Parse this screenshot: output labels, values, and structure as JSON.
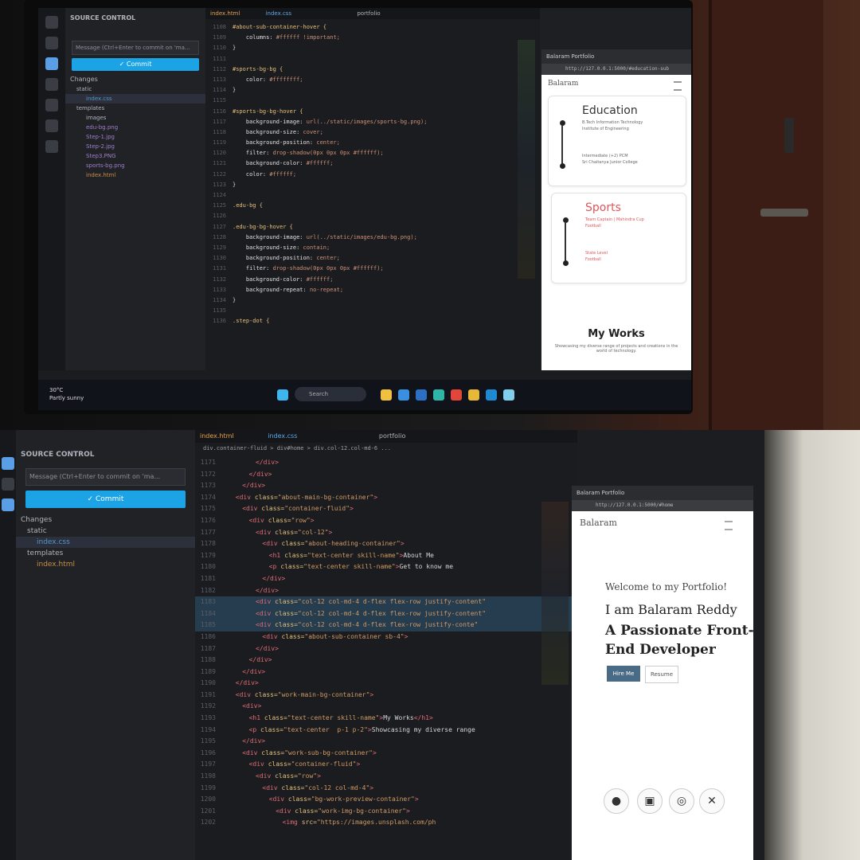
{
  "top": {
    "explorer": {
      "title": "SOURCE CONTROL",
      "commit_placeholder": "Message (Ctrl+Enter to commit on 'ma...",
      "commit_label": "✓ Commit",
      "changes_label": "Changes",
      "items": [
        "static",
        "index.css",
        "templates",
        "images",
        "edu-bg.png",
        "Step-1.jpg",
        "Step-2.jpg",
        "Step3.PNG",
        "sports-bg.png",
        "index.html"
      ]
    },
    "tabs": [
      "index.html",
      "index.css",
      "portfolio"
    ],
    "code_lines": [
      {
        "n": "1108",
        "parts": [
          [
            "sel",
            "#about-sub-container-hover {"
          ]
        ]
      },
      {
        "n": "1109",
        "parts": [
          [
            "prop",
            "    columns: "
          ],
          [
            "val",
            "#ffffff !important;"
          ]
        ]
      },
      {
        "n": "1110",
        "parts": [
          [
            "txt",
            "}"
          ]
        ]
      },
      {
        "n": "1111",
        "parts": [
          [
            "txt",
            ""
          ]
        ]
      },
      {
        "n": "1112",
        "parts": [
          [
            "sel",
            "#sports-bg-bg {"
          ]
        ]
      },
      {
        "n": "1113",
        "parts": [
          [
            "prop",
            "    color: "
          ],
          [
            "val",
            "#ffffffff;"
          ]
        ]
      },
      {
        "n": "1114",
        "parts": [
          [
            "txt",
            "}"
          ]
        ]
      },
      {
        "n": "1115",
        "parts": [
          [
            "txt",
            ""
          ]
        ]
      },
      {
        "n": "1116",
        "parts": [
          [
            "sel",
            "#sports-bg-bg-hover {"
          ]
        ]
      },
      {
        "n": "1117",
        "parts": [
          [
            "prop",
            "    background-image: "
          ],
          [
            "val",
            "url(../static/images/sports-bg.png);"
          ]
        ]
      },
      {
        "n": "1118",
        "parts": [
          [
            "prop",
            "    background-size: "
          ],
          [
            "val",
            "cover;"
          ]
        ]
      },
      {
        "n": "1119",
        "parts": [
          [
            "prop",
            "    background-position: "
          ],
          [
            "val",
            "center;"
          ]
        ]
      },
      {
        "n": "1120",
        "parts": [
          [
            "prop",
            "    filter: "
          ],
          [
            "val",
            "drop-shadow(0px 0px 0px #ffffff);"
          ]
        ]
      },
      {
        "n": "1121",
        "parts": [
          [
            "prop",
            "    background-color: "
          ],
          [
            "val",
            "#ffffff;"
          ]
        ]
      },
      {
        "n": "1122",
        "parts": [
          [
            "prop",
            "    color: "
          ],
          [
            "val",
            "#ffffff;"
          ]
        ]
      },
      {
        "n": "1123",
        "parts": [
          [
            "txt",
            "}"
          ]
        ]
      },
      {
        "n": "1124",
        "parts": [
          [
            "txt",
            ""
          ]
        ]
      },
      {
        "n": "1125",
        "parts": [
          [
            "sel",
            ".edu-bg {"
          ]
        ]
      },
      {
        "n": "1126",
        "parts": [
          [
            "txt",
            ""
          ]
        ]
      },
      {
        "n": "1127",
        "parts": [
          [
            "sel",
            ".edu-bg-bg-hover {"
          ]
        ]
      },
      {
        "n": "1128",
        "parts": [
          [
            "prop",
            "    background-image: "
          ],
          [
            "val",
            "url(../static/images/edu-bg.png);"
          ]
        ]
      },
      {
        "n": "1129",
        "parts": [
          [
            "prop",
            "    background-size: "
          ],
          [
            "val",
            "contain;"
          ]
        ]
      },
      {
        "n": "1130",
        "parts": [
          [
            "prop",
            "    background-position: "
          ],
          [
            "val",
            "center;"
          ]
        ]
      },
      {
        "n": "1131",
        "parts": [
          [
            "prop",
            "    filter: "
          ],
          [
            "val",
            "drop-shadow(0px 0px 0px #ffffff);"
          ]
        ]
      },
      {
        "n": "1132",
        "parts": [
          [
            "prop",
            "    background-color: "
          ],
          [
            "val",
            "#ffffff;"
          ]
        ]
      },
      {
        "n": "1133",
        "parts": [
          [
            "prop",
            "    background-repeat: "
          ],
          [
            "val",
            "no-repeat;"
          ]
        ]
      },
      {
        "n": "1134",
        "parts": [
          [
            "txt",
            "}"
          ]
        ]
      },
      {
        "n": "1135",
        "parts": [
          [
            "txt",
            ""
          ]
        ]
      },
      {
        "n": "1136",
        "parts": [
          [
            "sel",
            ".step-dot {"
          ]
        ]
      }
    ],
    "browser": {
      "tab_title": "Balaram Portfolio",
      "url": "http://127.0.0.1:5000/#education-sub",
      "site_name": "Balaram",
      "education_title": "Education",
      "education_line1": "B.Tech Information Technology",
      "education_line2": "Institute of Engineering",
      "education_line3": "Intermediate (+2) PCM",
      "education_line4": "Sri Chaitanya Junior College",
      "sports_title": "Sports",
      "sports_line1": "Team Captain | Mahindra Cup",
      "sports_line2": "Football",
      "sports_line3": "State Level",
      "sports_line4": "Football",
      "works_title": "My Works",
      "works_line": "Showcasing my diverse range of projects and creations in the world of technology."
    },
    "taskbar": {
      "search_label": "Search",
      "weather_temp": "30°C",
      "weather_desc": "Partly sunny"
    }
  },
  "bottom": {
    "explorer": {
      "title": "SOURCE CONTROL",
      "commit_placeholder": "Message (Ctrl+Enter to commit on 'ma...",
      "commit_label": "✓ Commit",
      "changes_label": "Changes",
      "items": [
        "static",
        "index.css",
        "templates",
        "index.html"
      ]
    },
    "tabs": [
      "index.html",
      "index.css",
      "portfolio"
    ],
    "breadcrumb": "div.container-fluid > div#home > div.col-12.col-md-6 ...",
    "code_lines": [
      {
        "n": "1171",
        "indent": 10,
        "parts": [
          [
            "tag",
            "</div>"
          ]
        ]
      },
      {
        "n": "1172",
        "indent": 8,
        "parts": [
          [
            "tag",
            "</div>"
          ]
        ]
      },
      {
        "n": "1173",
        "indent": 6,
        "parts": [
          [
            "tag",
            "</div>"
          ]
        ]
      },
      {
        "n": "1174",
        "indent": 4,
        "parts": [
          [
            "tag",
            "<div "
          ],
          [
            "attr",
            "class="
          ],
          [
            "str",
            "\"about-main-bg-container\""
          ],
          [
            "tag",
            ">"
          ]
        ]
      },
      {
        "n": "1175",
        "indent": 6,
        "parts": [
          [
            "tag",
            "<div "
          ],
          [
            "attr",
            "class="
          ],
          [
            "str",
            "\"container-fluid\""
          ],
          [
            "tag",
            ">"
          ]
        ]
      },
      {
        "n": "1176",
        "indent": 8,
        "parts": [
          [
            "tag",
            "<div "
          ],
          [
            "attr",
            "class="
          ],
          [
            "str",
            "\"row\""
          ],
          [
            "tag",
            ">"
          ]
        ]
      },
      {
        "n": "1177",
        "indent": 10,
        "parts": [
          [
            "tag",
            "<div "
          ],
          [
            "attr",
            "class="
          ],
          [
            "str",
            "\"col-12\""
          ],
          [
            "tag",
            ">"
          ]
        ]
      },
      {
        "n": "1178",
        "indent": 12,
        "parts": [
          [
            "tag",
            "<div "
          ],
          [
            "attr",
            "class="
          ],
          [
            "str",
            "\"about-heading-container\""
          ],
          [
            "tag",
            ">"
          ]
        ]
      },
      {
        "n": "1179",
        "indent": 14,
        "parts": [
          [
            "tag",
            "<h1 "
          ],
          [
            "attr",
            "class="
          ],
          [
            "str",
            "\"text-center skill-name\""
          ],
          [
            "tag",
            ">"
          ],
          [
            "txt",
            "About Me"
          ]
        ]
      },
      {
        "n": "1180",
        "indent": 14,
        "parts": [
          [
            "tag",
            "<p "
          ],
          [
            "attr",
            "class="
          ],
          [
            "str",
            "\"text-center skill-name\""
          ],
          [
            "tag",
            ">"
          ],
          [
            "txt",
            "Get to know me"
          ]
        ]
      },
      {
        "n": "1181",
        "indent": 12,
        "parts": [
          [
            "tag",
            "</div>"
          ]
        ]
      },
      {
        "n": "1182",
        "indent": 10,
        "parts": [
          [
            "tag",
            "</div>"
          ]
        ]
      },
      {
        "n": "1183",
        "indent": 10,
        "parts": [
          [
            "tag",
            "<div "
          ],
          [
            "attr",
            "class="
          ],
          [
            "str",
            "\"col-12 col-md-4 d-flex flex-row justify-content\""
          ]
        ]
      },
      {
        "n": "1184",
        "indent": 10,
        "parts": [
          [
            "tag",
            "<div "
          ],
          [
            "attr",
            "class="
          ],
          [
            "str",
            "\"col-12 col-md-4 d-flex flex-row justify-content\""
          ]
        ]
      },
      {
        "n": "1185",
        "indent": 10,
        "parts": [
          [
            "tag",
            "<div "
          ],
          [
            "attr",
            "class="
          ],
          [
            "str",
            "\"col-12 col-md-4 d-flex flex-row justify-conte\""
          ]
        ]
      },
      {
        "n": "1186",
        "indent": 12,
        "parts": [
          [
            "tag",
            "<div "
          ],
          [
            "attr",
            "class="
          ],
          [
            "str",
            "\"about-sub-container sb-4\""
          ],
          [
            "tag",
            ">"
          ]
        ]
      },
      {
        "n": "1187",
        "indent": 10,
        "parts": [
          [
            "tag",
            "</div>"
          ]
        ]
      },
      {
        "n": "1188",
        "indent": 8,
        "parts": [
          [
            "tag",
            "</div>"
          ]
        ]
      },
      {
        "n": "1189",
        "indent": 6,
        "parts": [
          [
            "tag",
            "</div>"
          ]
        ]
      },
      {
        "n": "1190",
        "indent": 4,
        "parts": [
          [
            "tag",
            "</div>"
          ]
        ]
      },
      {
        "n": "1191",
        "indent": 4,
        "parts": [
          [
            "tag",
            "<div "
          ],
          [
            "attr",
            "class="
          ],
          [
            "str",
            "\"work-main-bg-container\""
          ],
          [
            "tag",
            ">"
          ]
        ]
      },
      {
        "n": "1192",
        "indent": 6,
        "parts": [
          [
            "tag",
            "<div>"
          ]
        ]
      },
      {
        "n": "1193",
        "indent": 8,
        "parts": [
          [
            "tag",
            "<h1 "
          ],
          [
            "attr",
            "class="
          ],
          [
            "str",
            "\"text-center skill-name\""
          ],
          [
            "tag",
            ">"
          ],
          [
            "txt",
            "My Works"
          ],
          [
            "tag",
            "</h1>"
          ]
        ]
      },
      {
        "n": "1194",
        "indent": 8,
        "parts": [
          [
            "tag",
            "<p "
          ],
          [
            "attr",
            "class="
          ],
          [
            "str",
            "\"text-center  p-1 p-2\""
          ],
          [
            "tag",
            ">"
          ],
          [
            "txt",
            "Showcasing my diverse range"
          ]
        ]
      },
      {
        "n": "1195",
        "indent": 6,
        "parts": [
          [
            "tag",
            "</div>"
          ]
        ]
      },
      {
        "n": "1196",
        "indent": 6,
        "parts": [
          [
            "tag",
            "<div "
          ],
          [
            "attr",
            "class="
          ],
          [
            "str",
            "\"work-sub-bg-container\""
          ],
          [
            "tag",
            ">"
          ]
        ]
      },
      {
        "n": "1197",
        "indent": 8,
        "parts": [
          [
            "tag",
            "<div "
          ],
          [
            "attr",
            "class="
          ],
          [
            "str",
            "\"container-fluid\""
          ],
          [
            "tag",
            ">"
          ]
        ]
      },
      {
        "n": "1198",
        "indent": 10,
        "parts": [
          [
            "tag",
            "<div "
          ],
          [
            "attr",
            "class="
          ],
          [
            "str",
            "\"row\""
          ],
          [
            "tag",
            ">"
          ]
        ]
      },
      {
        "n": "1199",
        "indent": 12,
        "parts": [
          [
            "tag",
            "<div "
          ],
          [
            "attr",
            "class="
          ],
          [
            "str",
            "\"col-12 col-md-4\""
          ],
          [
            "tag",
            ">"
          ]
        ]
      },
      {
        "n": "1200",
        "indent": 14,
        "parts": [
          [
            "tag",
            "<div "
          ],
          [
            "attr",
            "class="
          ],
          [
            "str",
            "\"bg-work-preview-container\""
          ],
          [
            "tag",
            ">"
          ]
        ]
      },
      {
        "n": "1201",
        "indent": 16,
        "parts": [
          [
            "tag",
            "<div "
          ],
          [
            "attr",
            "class="
          ],
          [
            "str",
            "\"work-img-bg-container\""
          ],
          [
            "tag",
            ">"
          ]
        ]
      },
      {
        "n": "1202",
        "indent": 18,
        "parts": [
          [
            "tag",
            "<img "
          ],
          [
            "attr",
            "src="
          ],
          [
            "str",
            "\"https://images.unsplash.com/ph"
          ]
        ]
      }
    ],
    "browser": {
      "tab_title": "Balaram Portfolio",
      "url": "http://127.0.0.1:5000/#home",
      "site_name": "Balaram",
      "welcome": "Welcome to my Portfolio!",
      "name_line": "I am Balaram Reddy",
      "role_line1": "A Passionate Front-",
      "role_line2": "End Developer",
      "hire_button": "Hire Me",
      "resume_button": "Resume",
      "socials": [
        "github",
        "linkedin",
        "instagram",
        "x"
      ]
    }
  },
  "colors": {
    "accent": "#1ba3e6",
    "sports_red": "#e0565b",
    "hire_btn": "#4a6b86"
  }
}
